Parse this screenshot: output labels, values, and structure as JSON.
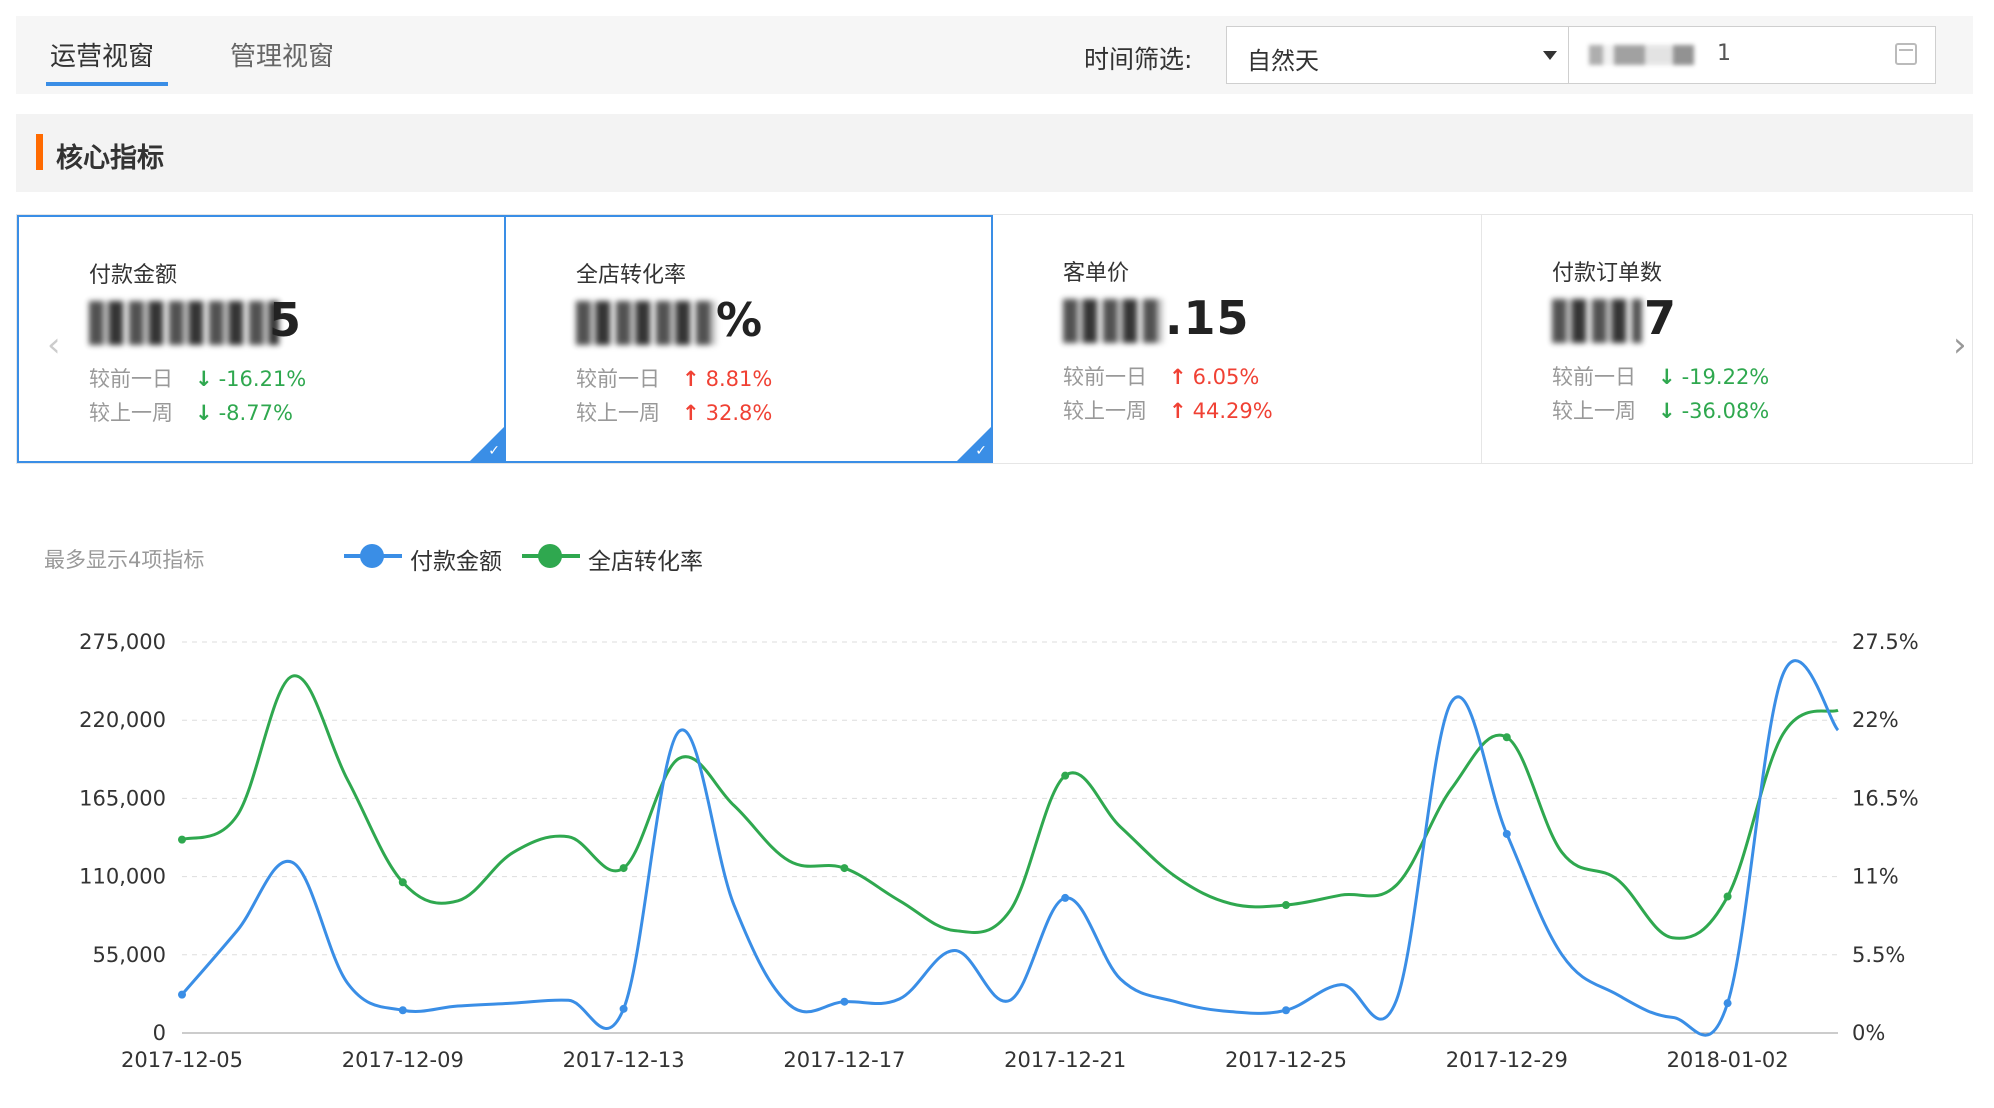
{
  "tabs": [
    {
      "label": "运营视窗",
      "active": true
    },
    {
      "label": "管理视窗",
      "active": false
    }
  ],
  "filter": {
    "label": "时间筛选:",
    "select_value": "自然天",
    "date_value_visible_digit": "1"
  },
  "section": {
    "title": "核心指标"
  },
  "cards": [
    {
      "name": "付款金额",
      "value_visible": "1,",
      "value_suffix": "5",
      "day_label": "较前一日",
      "day_dir": "down",
      "day_pct": "-16.21%",
      "week_label": "较上一周",
      "week_dir": "down",
      "week_pct": "-8.77%",
      "selected": true
    },
    {
      "name": "全店转化率",
      "value_visible": "2",
      "value_suffix": "%",
      "day_label": "较前一日",
      "day_dir": "up",
      "day_pct": "8.81%",
      "week_label": "较上一周",
      "week_dir": "up",
      "week_pct": "32.8%",
      "selected": true
    },
    {
      "name": "客单价",
      "value_visible": "7",
      "value_suffix": ".15",
      "day_label": "较前一日",
      "day_dir": "up",
      "day_pct": "6.05%",
      "week_label": "较上一周",
      "week_dir": "up",
      "week_pct": "44.29%",
      "selected": false
    },
    {
      "name": "付款订单数",
      "value_visible": "",
      "value_suffix": "7",
      "day_label": "较前一日",
      "day_dir": "down",
      "day_pct": "-19.22%",
      "week_label": "较上一周",
      "week_dir": "down",
      "week_pct": "-36.08%",
      "selected": false
    }
  ],
  "legend_hint": "最多显示4项指标",
  "colors": {
    "blue": "#3a8ee6",
    "green": "#2fa84f",
    "up": "#f04134",
    "down": "#2fa84f",
    "accent": "#ff6a00"
  },
  "chart_data": {
    "type": "line",
    "x": [
      "2017-12-05",
      "2017-12-06",
      "2017-12-07",
      "2017-12-08",
      "2017-12-09",
      "2017-12-10",
      "2017-12-11",
      "2017-12-12",
      "2017-12-13",
      "2017-12-14",
      "2017-12-15",
      "2017-12-16",
      "2017-12-17",
      "2017-12-18",
      "2017-12-19",
      "2017-12-20",
      "2017-12-21",
      "2017-12-22",
      "2017-12-23",
      "2017-12-24",
      "2017-12-25",
      "2017-12-26",
      "2017-12-27",
      "2017-12-28",
      "2017-12-29",
      "2017-12-30",
      "2017-12-31",
      "2018-01-01",
      "2018-01-02",
      "2018-01-03",
      "2018-01-04"
    ],
    "x_tick_labels": [
      "2017-12-05",
      "2017-12-09",
      "2017-12-13",
      "2017-12-17",
      "2017-12-21",
      "2017-12-25",
      "2017-12-29",
      "2018-01-02"
    ],
    "series": [
      {
        "name": "付款金额",
        "axis": "left",
        "color": "#3a8ee6",
        "values": [
          27000,
          72000,
          120000,
          35000,
          16000,
          19000,
          21000,
          23000,
          17000,
          212000,
          90000,
          20000,
          22000,
          24000,
          58000,
          23000,
          95000,
          38000,
          22000,
          15000,
          16000,
          34000,
          23000,
          233000,
          140000,
          55000,
          27000,
          11000,
          21000,
          252000,
          213000
        ]
      },
      {
        "name": "全店转化率",
        "axis": "right",
        "color": "#2fa84f",
        "values": [
          13.6,
          15.3,
          25.1,
          17.8,
          10.6,
          9.3,
          12.7,
          13.8,
          11.6,
          19.3,
          16.0,
          12.1,
          11.6,
          9.3,
          7.2,
          8.6,
          18.1,
          14.5,
          11.0,
          9.1,
          9.0,
          9.7,
          10.4,
          17.2,
          20.8,
          12.7,
          10.8,
          6.7,
          9.6,
          21.0,
          22.7
        ]
      }
    ],
    "y_left": {
      "ticks": [
        "0",
        "55,000",
        "110,000",
        "165,000",
        "220,000",
        "275,000"
      ],
      "lim": [
        0,
        275000
      ]
    },
    "y_right": {
      "ticks": [
        "0%",
        "5.5%",
        "11%",
        "16.5%",
        "22%",
        "27.5%"
      ],
      "lim": [
        0,
        27.5
      ]
    },
    "grid": true,
    "legend_position": "top-left"
  }
}
